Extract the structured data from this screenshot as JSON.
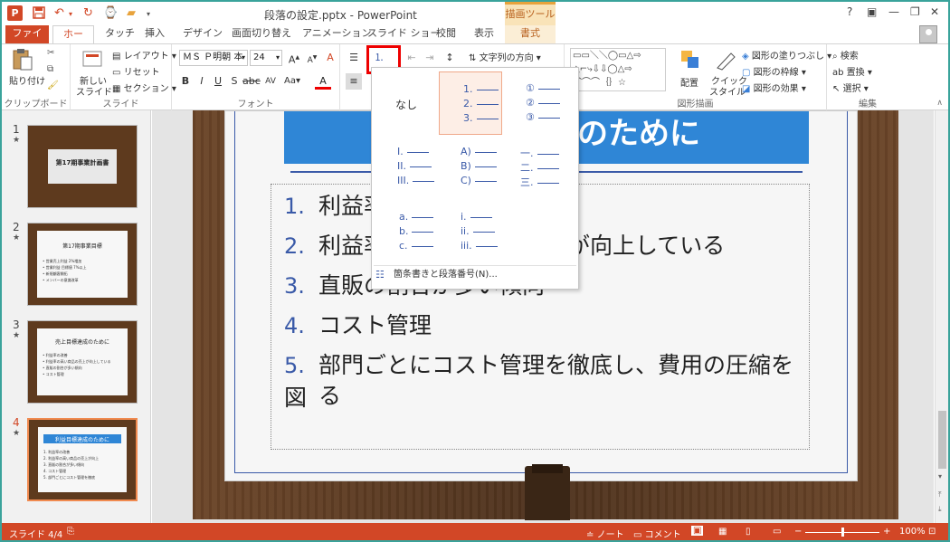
{
  "window": {
    "title": "段落の設定.pptx - PowerPoint",
    "contextual_tab_group": "描画ツール",
    "help": "?"
  },
  "tabs": [
    {
      "label": "ファイル"
    },
    {
      "label": "ホーム"
    },
    {
      "label": "タッチ"
    },
    {
      "label": "挿入"
    },
    {
      "label": "デザイン"
    },
    {
      "label": "画面切り替え"
    },
    {
      "label": "アニメーション"
    },
    {
      "label": "スライド ショー"
    },
    {
      "label": "校閲"
    },
    {
      "label": "表示"
    },
    {
      "label": "書式"
    }
  ],
  "ribbon": {
    "clipboard": {
      "label": "クリップボード",
      "paste": "貼り付け"
    },
    "slides": {
      "label": "スライド",
      "new_slide_1": "新しい",
      "new_slide_2": "スライド",
      "layout": "レイアウト",
      "reset": "リセット",
      "section": "セクション"
    },
    "font": {
      "label": "フォント",
      "font_name": "ＭＳ Ｐ明朝 本",
      "font_size": "24"
    },
    "paragraph": {
      "text_direction": "文字列の方向"
    },
    "drawing": {
      "label": "図形描画",
      "arrange": "配置",
      "quick_style_1": "クイック",
      "quick_style_2": "スタイル",
      "fill": "図形の塗りつぶし",
      "outline": "図形の枠線",
      "effects": "図形の効果"
    },
    "editing": {
      "label": "編集",
      "find": "検索",
      "replace": "置換",
      "select": "選択"
    }
  },
  "numbering_menu": {
    "none_label": "なし",
    "options": [
      {
        "rows": [
          "1.",
          "2.",
          "3."
        ]
      },
      {
        "rows": [
          "①",
          "②",
          "③"
        ]
      },
      {
        "rows": [
          "I.",
          "II.",
          "III."
        ]
      },
      {
        "rows": [
          "A)",
          "B)",
          "C)"
        ]
      },
      {
        "rows": [
          "一.",
          "二.",
          "三."
        ]
      },
      {
        "rows": [
          "a.",
          "b.",
          "c."
        ]
      },
      {
        "rows": [
          "i.",
          "ii.",
          "iii."
        ]
      }
    ],
    "footer": "箇条書きと段落番号(N)..."
  },
  "thumbnails": [
    {
      "num": "1",
      "star": "★",
      "title": "第17期事業計画書",
      "bullets": []
    },
    {
      "num": "2",
      "star": "★",
      "title": "第17期事業目標",
      "bullets": [
        "• 営業売上利益 2%増加",
        "• 営業利益 目標値 7%以上",
        "• 新規顧客開拓",
        "• メンバーの意識改革"
      ]
    },
    {
      "num": "3",
      "star": "★",
      "title": "売上目標達成のために",
      "bullets": [
        "• 利益率の改善",
        "• 利益率の高い商品の売上が向上している",
        "• 直販の割合が多い傾向",
        "• コスト管理"
      ]
    },
    {
      "num": "4",
      "star": "★",
      "title": "利益目標達成のために",
      "bullets": [
        "1. 利益率の改善",
        "2. 利益率の高い商品の売上が向上",
        "3. 直販の割合が多い傾向",
        "4. コスト管理",
        "5. 部門ごとにコスト管理を徹底"
      ]
    }
  ],
  "slide": {
    "title": "利益目標達成のために",
    "items": [
      {
        "n": "1.",
        "text": "利益率の改善"
      },
      {
        "n": "2.",
        "text": "利益率の高い商品の売上が向上している"
      },
      {
        "n": "3.",
        "text": "直販の割合が多い傾向"
      },
      {
        "n": "4.",
        "text": "コスト管理"
      },
      {
        "n": "5.",
        "text": "部門ごとにコスト管理を徹底し、費用の圧縮を図"
      }
    ],
    "item5_cont": "る"
  },
  "statusbar": {
    "slide_pos": "スライド 4/4",
    "notes": "ノート",
    "comments": "コメント",
    "zoom": "100%"
  }
}
